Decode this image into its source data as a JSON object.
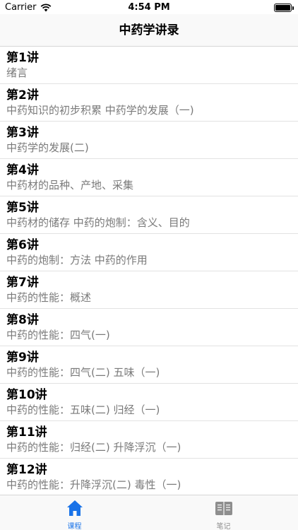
{
  "status_bar": {
    "carrier": "Carrier",
    "time": "4:54 PM",
    "battery_level": 1.0
  },
  "nav": {
    "title": "中药学讲录"
  },
  "lectures": [
    {
      "title": "第1讲",
      "subtitle": "绪言"
    },
    {
      "title": "第2讲",
      "subtitle": "中药知识的初步积累 中药学的发展（一)"
    },
    {
      "title": "第3讲",
      "subtitle": "中药学的发展(二)"
    },
    {
      "title": "第4讲",
      "subtitle": "中药材的品种、产地、采集"
    },
    {
      "title": "第5讲",
      "subtitle": "中药材的储存 中药的炮制：含义、目的"
    },
    {
      "title": "第6讲",
      "subtitle": "中药的炮制：方法 中药的作用"
    },
    {
      "title": "第7讲",
      "subtitle": "中药的性能：概述"
    },
    {
      "title": "第8讲",
      "subtitle": "中药的性能：四气(一)"
    },
    {
      "title": "第9讲",
      "subtitle": "中药的性能：四气(二) 五味（一)"
    },
    {
      "title": "第10讲",
      "subtitle": "中药的性能：五味(二) 归经（一)"
    },
    {
      "title": "第11讲",
      "subtitle": "中药的性能：归经(二) 升降浮沉（一)"
    },
    {
      "title": "第12讲",
      "subtitle": "中药的性能：升降浮沉(二) 毒性（一)"
    }
  ],
  "tabs": [
    {
      "label": "课程",
      "icon": "home-icon",
      "active": true
    },
    {
      "label": "笔记",
      "icon": "notebook-icon",
      "active": false
    }
  ],
  "colors": {
    "accent": "#1a73e8",
    "inactive": "#8e8e8e",
    "subtitle": "#7a7a7a"
  }
}
